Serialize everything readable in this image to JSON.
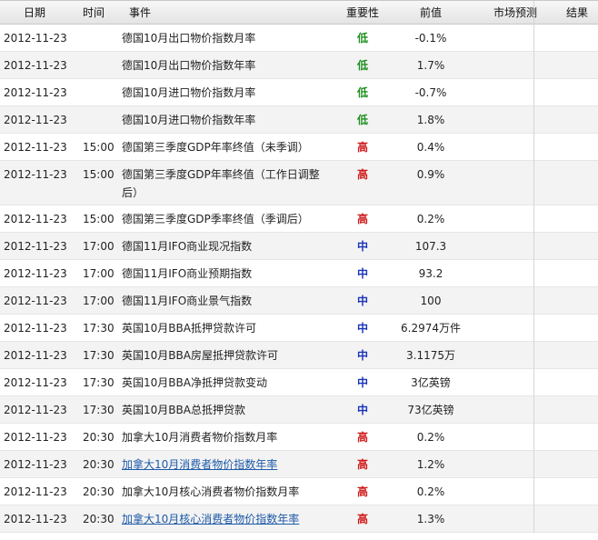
{
  "headers": {
    "date": "日期",
    "time": "时间",
    "event": "事件",
    "importance": "重要性",
    "previous": "前值",
    "forecast": "市场预测",
    "result": "结果"
  },
  "rows": [
    {
      "date": "2012-11-23",
      "time": "",
      "event": "德国10月出口物价指数月率",
      "importance": "低",
      "previous": "-0.1%"
    },
    {
      "date": "2012-11-23",
      "time": "",
      "event": "德国10月出口物价指数年率",
      "importance": "低",
      "previous": "1.7%"
    },
    {
      "date": "2012-11-23",
      "time": "",
      "event": "德国10月进口物价指数月率",
      "importance": "低",
      "previous": "-0.7%"
    },
    {
      "date": "2012-11-23",
      "time": "",
      "event": "德国10月进口物价指数年率",
      "importance": "低",
      "previous": "1.8%"
    },
    {
      "date": "2012-11-23",
      "time": "15:00",
      "event": "德国第三季度GDP年率终值（未季调）",
      "importance": "高",
      "previous": "0.4%"
    },
    {
      "date": "2012-11-23",
      "time": "15:00",
      "event": "德国第三季度GDP年率终值（工作日调整后）",
      "importance": "高",
      "previous": "0.9%"
    },
    {
      "date": "2012-11-23",
      "time": "15:00",
      "event": "德国第三季度GDP季率终值（季调后）",
      "importance": "高",
      "previous": "0.2%"
    },
    {
      "date": "2012-11-23",
      "time": "17:00",
      "event": "德国11月IFO商业现况指数",
      "importance": "中",
      "previous": "107.3"
    },
    {
      "date": "2012-11-23",
      "time": "17:00",
      "event": "德国11月IFO商业预期指数",
      "importance": "中",
      "previous": "93.2"
    },
    {
      "date": "2012-11-23",
      "time": "17:00",
      "event": "德国11月IFO商业景气指数",
      "importance": "中",
      "previous": "100"
    },
    {
      "date": "2012-11-23",
      "time": "17:30",
      "event": "英国10月BBA抵押贷款许可",
      "importance": "中",
      "previous": "6.2974万件"
    },
    {
      "date": "2012-11-23",
      "time": "17:30",
      "event": "英国10月BBA房屋抵押贷款许可",
      "importance": "中",
      "previous": "3.1175万"
    },
    {
      "date": "2012-11-23",
      "time": "17:30",
      "event": "英国10月BBA净抵押贷款变动",
      "importance": "中",
      "previous": "3亿英镑"
    },
    {
      "date": "2012-11-23",
      "time": "17:30",
      "event": "英国10月BBA总抵押贷款",
      "importance": "中",
      "previous": "73亿英镑"
    },
    {
      "date": "2012-11-23",
      "time": "20:30",
      "event": "加拿大10月消费者物价指数月率",
      "importance": "高",
      "previous": "0.2%"
    },
    {
      "date": "2012-11-23",
      "time": "20:30",
      "event": "加拿大10月消费者物价指数年率",
      "importance": "高",
      "previous": "1.2%"
    },
    {
      "date": "2012-11-23",
      "time": "20:30",
      "event": "加拿大10月核心消费者物价指数月率",
      "importance": "高",
      "previous": "0.2%"
    },
    {
      "date": "2012-11-23",
      "time": "20:30",
      "event": "加拿大10月核心消费者物价指数年率",
      "importance": "高",
      "previous": "1.3%"
    }
  ],
  "colors": {
    "low": "#1f8f1f",
    "high": "#d01818",
    "mid": "#1a34b8",
    "link": "#1e5aa8"
  }
}
